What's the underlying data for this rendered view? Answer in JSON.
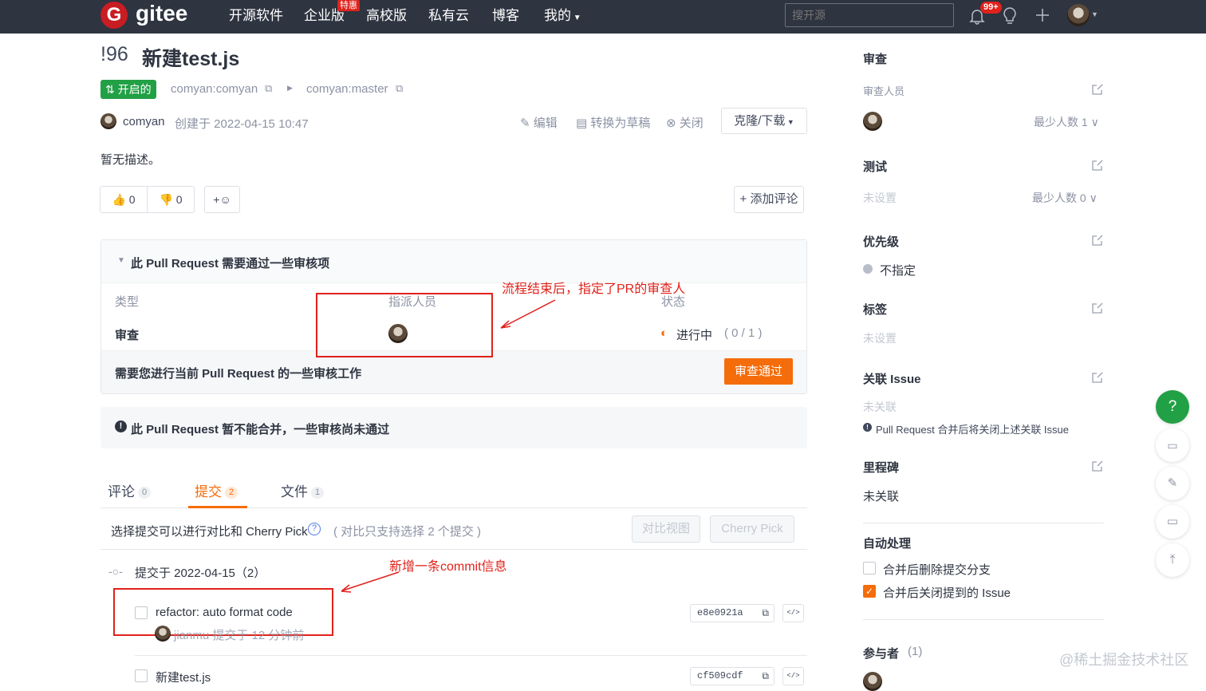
{
  "nav": {
    "logo_letter": "G",
    "logo_text": "gitee",
    "items": [
      "开源软件",
      "企业版",
      "高校版",
      "私有云",
      "博客",
      "我的"
    ],
    "hot_badge": "特惠",
    "search_placeholder": "搜开源",
    "notif_count": "99+"
  },
  "pr": {
    "number": "!96",
    "title": "新建test.js",
    "status": "开启的",
    "source_branch": "comyan:comyan",
    "target_branch": "comyan:master",
    "author": "comyan",
    "created": "创建于 2022-04-15 10:47",
    "actions": {
      "edit": "编辑",
      "draft": "转换为草稿",
      "close": "关闭",
      "clone": "克隆/下载"
    },
    "description": "暂无描述。",
    "reactions": {
      "up": "0",
      "down": "0",
      "add": "+"
    },
    "add_comment": "+ 添加评论"
  },
  "review": {
    "header": "此 Pull Request 需要通过一些审核项",
    "col_type": "类型",
    "col_assignee": "指派人员",
    "col_status": "状态",
    "row_type": "审查",
    "row_status": "进行中",
    "row_progress": "( 0 / 1 )",
    "notice": "需要您进行当前 Pull Request 的一些审核工作",
    "approve_btn": "审查通过"
  },
  "merge_notice": "此 Pull Request 暂不能合并，一些审核尚未通过",
  "annotations": {
    "reviewer": "流程结束后，指定了PR的审查人",
    "commit": "新增一条commit信息"
  },
  "tabs": [
    {
      "label": "评论",
      "count": "0"
    },
    {
      "label": "提交",
      "count": "2"
    },
    {
      "label": "文件",
      "count": "1"
    }
  ],
  "commits_bar": {
    "hint": "选择提交可以进行对比和 Cherry Pick",
    "sub_hint": "( 对比只支持选择 2 个提交 )",
    "compare_btn": "对比视图",
    "cherry_btn": "Cherry Pick"
  },
  "commit_group": "提交于 2022-04-15（2）",
  "commits": [
    {
      "message": "refactor: auto format code",
      "meta": "jianmu 提交于 12 分钟前",
      "sha": "e8e0921a",
      "code": "</>"
    },
    {
      "message": "新建test.js",
      "sha": "cf509cdf",
      "code": "</>"
    }
  ],
  "sidebar": {
    "review_title": "审查",
    "reviewers_label": "审查人员",
    "reviewers_min": "最少人数 1",
    "test_title": "测试",
    "test_value": "未设置",
    "test_min": "最少人数 0",
    "priority_title": "优先级",
    "priority_value": "不指定",
    "labels_title": "标签",
    "labels_value": "未设置",
    "issue_title": "关联 Issue",
    "issue_value": "未关联",
    "issue_note": "Pull Request 合并后将关闭上述关联 Issue",
    "milestone_title": "里程碑",
    "milestone_value": "未关联",
    "auto_title": "自动处理",
    "auto_opt1": "合并后删除提交分支",
    "auto_opt2": "合并后关闭提到的 Issue",
    "participants_title": "参与者",
    "participants_count": "(1)"
  },
  "watermark": "@稀土掘金技术社区",
  "colors": {
    "nav": "#2e3440",
    "open": "#22a046",
    "orange": "#f56c0a",
    "annotation": "#e0221b",
    "help": "#22a046"
  }
}
